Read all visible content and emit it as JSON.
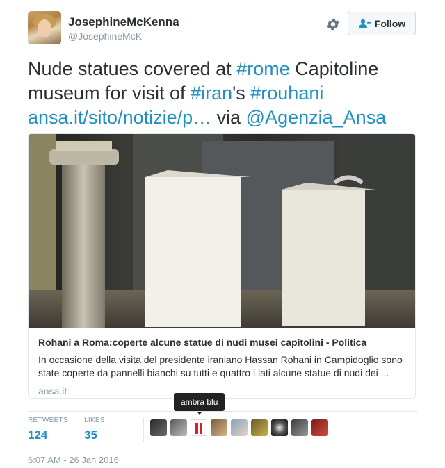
{
  "user": {
    "display_name": "JosephineMcKenna",
    "handle": "@JosephineMcK"
  },
  "actions": {
    "follow_label": "Follow"
  },
  "tweet": {
    "parts": {
      "t1": "Nude statues covered at ",
      "h1": "#rome",
      "t2": " Capitoline museum for visit of ",
      "h2": "#iran",
      "t3": "'s ",
      "h3": "#rouhani",
      "link": "ansa.it/sito/notizie/p…",
      "t4": " via ",
      "mention": "@Agenzia_Ansa"
    }
  },
  "card": {
    "title": "Rohani a Roma:coperte alcune statue di nudi musei capitolini - Politica",
    "description": "In occasione della visita del presidente iraniano Hassan Rohani in Campidoglio sono state coperte da pannelli bianchi su tutti e quattro i lati alcune statue di nudi dei ...",
    "domain": "ansa.it"
  },
  "tooltip": {
    "text": "ambra blu"
  },
  "stats": {
    "retweets_label": "RETWEETS",
    "retweets_value": "124",
    "likes_label": "LIKES",
    "likes_value": "35"
  },
  "likers_count_shown": 9,
  "timestamp": "6:07 AM - 26 Jan 2016",
  "colors": {
    "link": "#1f8fc4",
    "muted": "#8899a6",
    "text": "#292f33",
    "border": "#e1e8ed"
  }
}
